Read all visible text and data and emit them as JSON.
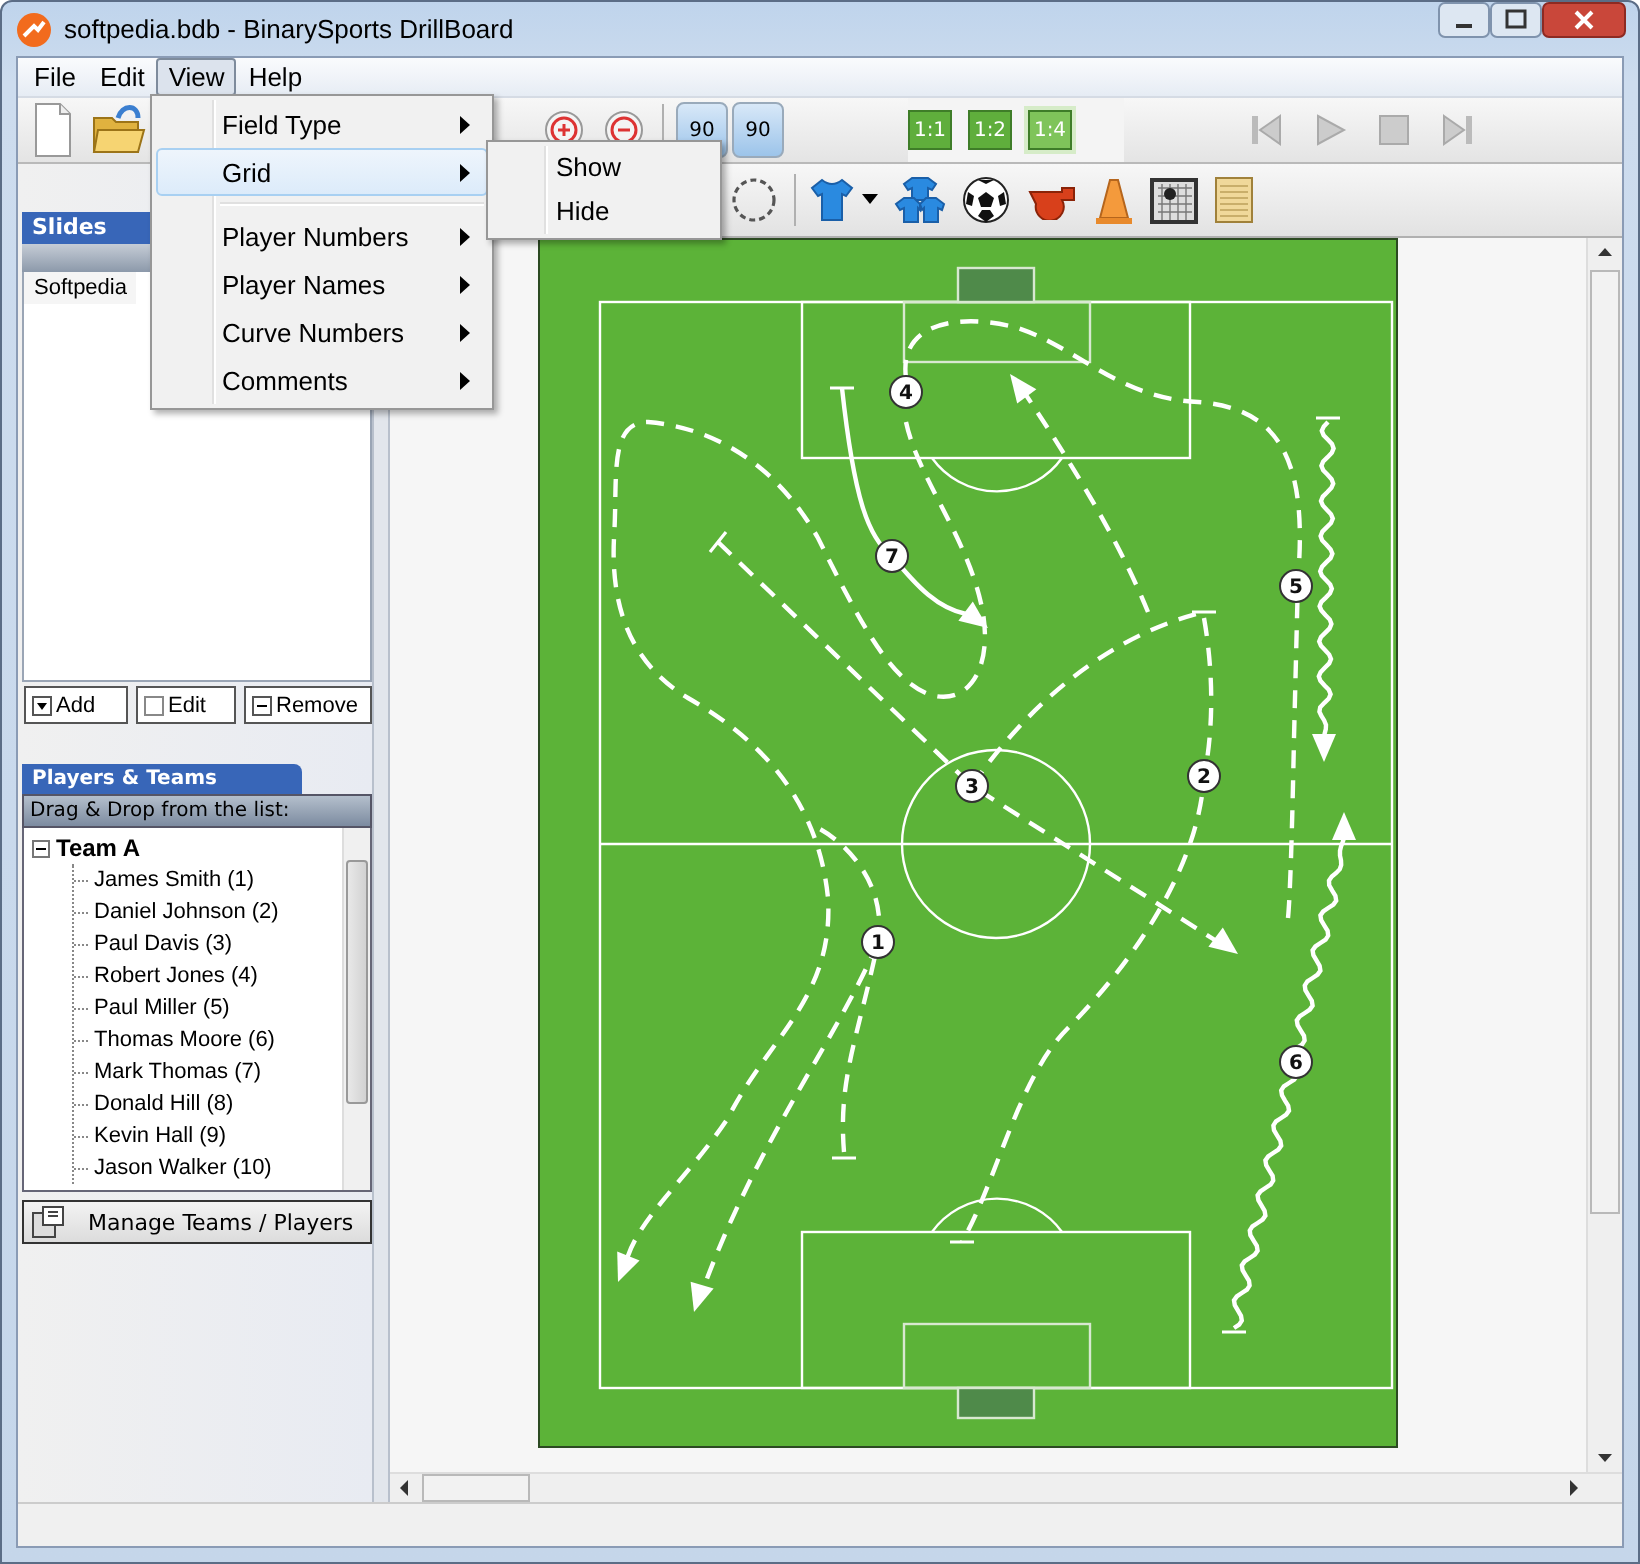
{
  "window": {
    "title": "softpedia.bdb - BinarySports DrillBoard"
  },
  "menu_bar": [
    {
      "label": "File",
      "selected": false
    },
    {
      "label": "Edit",
      "selected": false
    },
    {
      "label": "View",
      "selected": true
    },
    {
      "label": "Help",
      "selected": false
    }
  ],
  "view_menu": [
    {
      "kind": "submenu",
      "label": "Field Type",
      "highlighted": false
    },
    {
      "kind": "submenu",
      "label": "Grid",
      "highlighted": true
    },
    {
      "kind": "separator"
    },
    {
      "kind": "submenu",
      "label": "Player Numbers",
      "highlighted": false
    },
    {
      "kind": "submenu",
      "label": "Player Names",
      "highlighted": false
    },
    {
      "kind": "submenu",
      "label": "Curve Numbers",
      "highlighted": false
    },
    {
      "kind": "submenu",
      "label": "Comments",
      "highlighted": false
    }
  ],
  "grid_submenu": [
    "Show",
    "Hide"
  ],
  "rotate_buttons": [
    "90",
    "90"
  ],
  "scale_buttons": [
    {
      "label": "1:1",
      "selected": false
    },
    {
      "label": "1:2",
      "selected": false
    },
    {
      "label": "1:4",
      "selected": true
    }
  ],
  "slides": {
    "title": "Slides",
    "items": [
      {
        "label": "Softpedia"
      }
    ],
    "buttons": [
      "Add",
      "Edit",
      "Remove"
    ]
  },
  "players_panel": {
    "title": "Players & Teams",
    "hint": "Drag & Drop from the list:",
    "tree": [
      {
        "label": "Team A",
        "expanded": true,
        "children": [
          {
            "label": "James Smith (1)"
          },
          {
            "label": "Daniel Johnson (2)"
          },
          {
            "label": "Paul Davis (3)"
          },
          {
            "label": "Robert Jones (4)"
          },
          {
            "label": "Paul Miller (5)"
          },
          {
            "label": "Thomas Moore (6)"
          },
          {
            "label": "Mark Thomas (7)"
          },
          {
            "label": "Donald Hill (8)"
          },
          {
            "label": "Kevin Hall (9)"
          },
          {
            "label": "Jason Walker (10)"
          }
        ]
      }
    ],
    "manage_button": "Manage Teams / Players"
  },
  "field": {
    "markers": [
      {
        "label": "1"
      },
      {
        "label": "2"
      },
      {
        "label": "3"
      },
      {
        "label": "4"
      },
      {
        "label": "5"
      },
      {
        "label": "6"
      },
      {
        "label": "7"
      }
    ]
  }
}
